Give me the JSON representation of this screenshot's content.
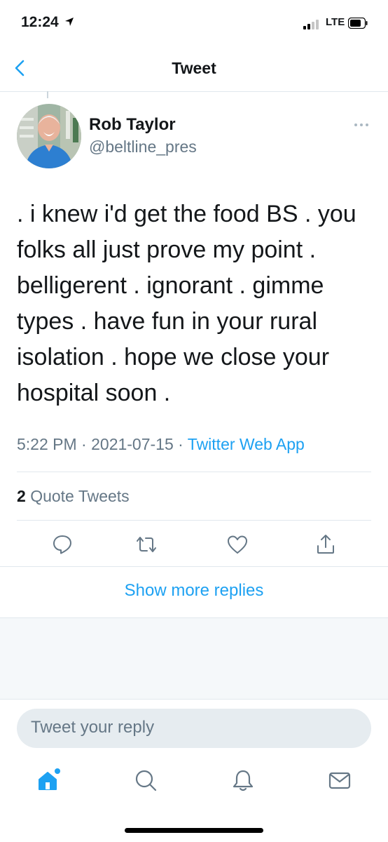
{
  "status_bar": {
    "time": "12:24",
    "network": "LTE"
  },
  "nav": {
    "title": "Tweet"
  },
  "tweet": {
    "author_name": "Rob Taylor",
    "author_handle": "@beltline_pres",
    "lines": [
      ". i knew i'd get the food BS . you",
      "folks all just prove my point .",
      "belligerent . ignorant . gimme",
      "types . have fun in  your rural",
      "isolation . hope we close  your",
      "hospital soon ."
    ],
    "time": "5:22 PM",
    "date": "2021-07-15",
    "separator": " · ",
    "source": "Twitter Web App",
    "quote_count": "2",
    "quote_label": "Quote Tweets"
  },
  "show_more": "Show more replies",
  "reply": {
    "placeholder": "Tweet your reply"
  },
  "colors": {
    "accent": "#1da1f2",
    "secondary_text": "#657786",
    "divider": "#e1e8ed"
  },
  "icons": [
    "back-icon",
    "more-icon",
    "reply-icon",
    "retweet-icon",
    "like-icon",
    "share-icon",
    "home-icon",
    "search-icon",
    "notifications-icon",
    "messages-icon"
  ]
}
